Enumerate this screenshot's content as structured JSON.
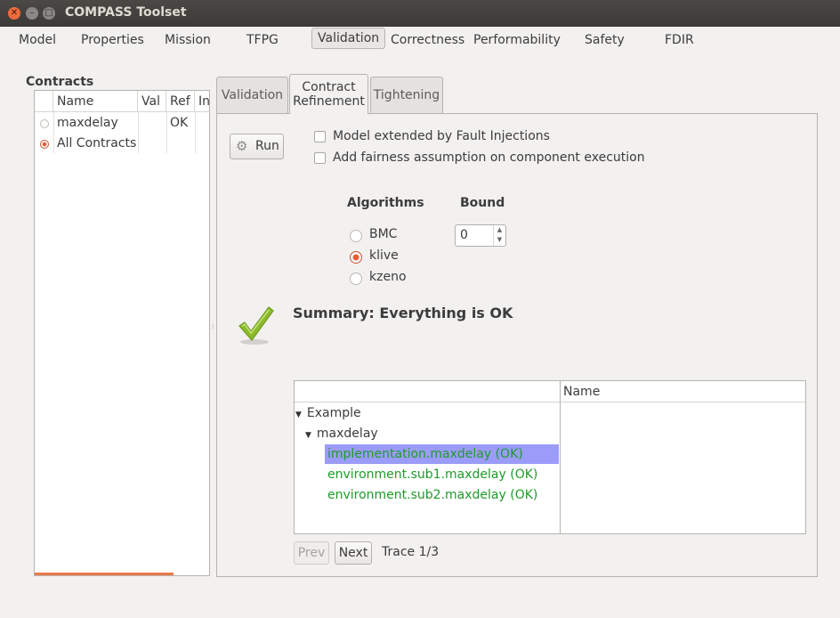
{
  "window": {
    "title": "COMPASS Toolset"
  },
  "menu": [
    {
      "label": "Model",
      "active": false
    },
    {
      "label": "Properties",
      "active": false
    },
    {
      "label": "Mission",
      "active": false
    },
    {
      "label": "TFPG",
      "active": false
    },
    {
      "label": "Validation",
      "active": true
    },
    {
      "label": "Correctness",
      "active": false
    },
    {
      "label": "Performability",
      "active": false
    },
    {
      "label": "Safety",
      "active": false
    },
    {
      "label": "FDIR",
      "active": false
    }
  ],
  "contracts": {
    "title": "Contracts",
    "columns": [
      "Name",
      "Val",
      "Ref",
      "In"
    ],
    "rows": [
      {
        "name": "maxdelay",
        "val": "",
        "ref": "OK",
        "selected": false
      },
      {
        "name": "All Contracts",
        "val": "",
        "ref": "",
        "selected": true
      }
    ],
    "accent": "#e9784a"
  },
  "tabs": [
    {
      "label": "Validation",
      "active": false
    },
    {
      "label": "Contract\nRefinement",
      "active": true
    },
    {
      "label": "Tightening",
      "active": false
    }
  ],
  "refinement": {
    "run_label": "Run",
    "options": [
      {
        "label": "Model extended by Fault Injections",
        "checked": false
      },
      {
        "label": "Add fairness assumption on component execution",
        "checked": false
      }
    ],
    "algorithms_title": "Algorithms",
    "bound_title": "Bound",
    "algorithms": [
      {
        "label": "BMC",
        "selected": false
      },
      {
        "label": "klive",
        "selected": true
      },
      {
        "label": "kzeno",
        "selected": false
      }
    ],
    "bound_value": "0",
    "summary": "Summary: Everything is OK",
    "tree": {
      "column_name": "Name",
      "root": "Example",
      "child": "maxdelay",
      "leaves": [
        {
          "label": "implementation.maxdelay (OK)",
          "selected": true
        },
        {
          "label": "environment.sub1.maxdelay (OK)",
          "selected": false
        },
        {
          "label": "environment.sub2.maxdelay (OK)",
          "selected": false
        }
      ]
    },
    "prev_label": "Prev",
    "next_label": "Next",
    "trace_label": "Trace 1/3",
    "ok_color": "#1f9b29"
  }
}
